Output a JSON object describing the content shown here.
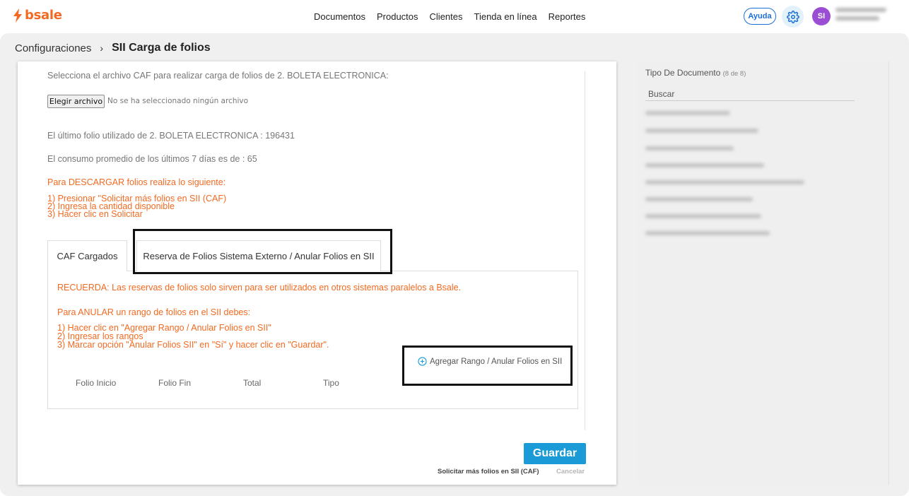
{
  "brand": {
    "name": "bsale",
    "color": "#f26a21"
  },
  "nav": {
    "items": [
      "Documentos",
      "Productos",
      "Clientes",
      "Tienda en línea",
      "Reportes"
    ]
  },
  "header": {
    "help_label": "Ayuda",
    "settings_icon": "gear-icon",
    "avatar_initials": "SI"
  },
  "breadcrumb": {
    "parent": "Configuraciones",
    "separator": "›",
    "current": "SII Carga de folios"
  },
  "form": {
    "select_caf_text": "Selecciona el archivo CAF para realizar carga de folios de 2. BOLETA ELECTRONICA:",
    "file_button_label": "Elegir archivo",
    "file_none_text": "No se ha seleccionado ningún archivo",
    "last_folio_text": "El último folio utilizado de 2. BOLETA ELECTRONICA : 196431",
    "avg_consumption_text": "El consumo promedio de los últimos 7 días es de : 65",
    "download_heading": "Para DESCARGAR folios realiza lo siguiente:",
    "download_steps": [
      "1) Presionar \"Solicitar más folios en SII (CAF)",
      "2) Ingresa la cantidad disponible",
      "3) Hacer clic en Solicitar"
    ]
  },
  "tabs": [
    {
      "label": "CAF Cargados"
    },
    {
      "label": "Reserva de Folios Sistema Externo / Anular Folios en SII"
    }
  ],
  "panel": {
    "reminder": "RECUERDA: Las reservas de folios solo sirven para ser utilizados en otros sistemas paralelos a Bsale.",
    "cancel_heading": "Para ANULAR un rango de folios en el SII debes:",
    "cancel_steps": [
      "1) Hacer clic en \"Agregar Rango / Anular Folios en SII\"",
      "2) Ingresar los rangos",
      "3) Marcar opción \"Anular Folios SII\" en \"Sí\" y hacer clic en \"Guardar\"."
    ],
    "add_range_label": "Agregar Rango / Anular Folios en SII",
    "columns": [
      "Folio Inicio",
      "Folio Fin",
      "Total",
      "Tipo"
    ]
  },
  "actions": {
    "save_label": "Guardar",
    "request_label": "Solicitar más folios en SII (CAF)",
    "cancel_label": "Cancelar",
    "save_color": "#1a9ad6"
  },
  "sidebar": {
    "title": "Tipo De Documento",
    "count": "(8 de 8)",
    "search_label": "Buscar"
  }
}
